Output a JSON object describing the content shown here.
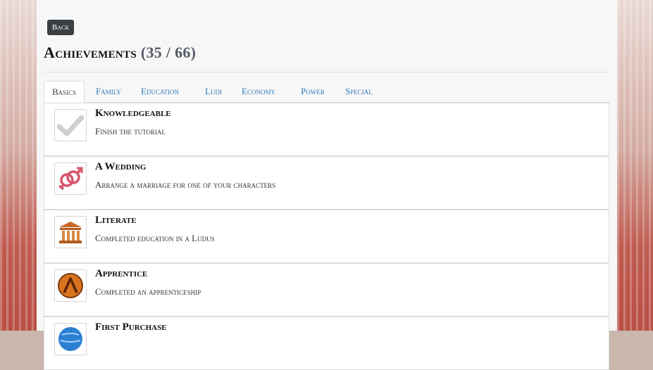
{
  "header": {
    "back_label": "Back",
    "title": "Achievements",
    "count": "(35 / 66)"
  },
  "tabs": [
    {
      "label": "Basics",
      "active": true
    },
    {
      "label": "Family"
    },
    {
      "label": "Education"
    },
    {
      "label": "Ludi"
    },
    {
      "label": "Economy"
    },
    {
      "label": "Power"
    },
    {
      "label": "Special"
    }
  ],
  "achievements": [
    {
      "title": "Knowledgeable",
      "description": "Finish the tutorial",
      "icon": "checkmark-icon"
    },
    {
      "title": "A Wedding",
      "description": "Arrange a marriage for one of your characters",
      "icon": "gender-symbols-icon"
    },
    {
      "title": "Literate",
      "description": "Completed education in a Ludus",
      "icon": "temple-icon"
    },
    {
      "title": "Apprentice",
      "description": "Completed an apprenticeship",
      "icon": "lambda-shield-icon"
    },
    {
      "title": "First Purchase",
      "description": "",
      "icon": "globe-icon"
    }
  ],
  "colors": {
    "tab_link": "#2f79b9",
    "back_button": "#3a3f44",
    "wedding_icon": "#d8556a",
    "temple_icon": "#c76a28",
    "shield_icon": "#d9731f"
  }
}
